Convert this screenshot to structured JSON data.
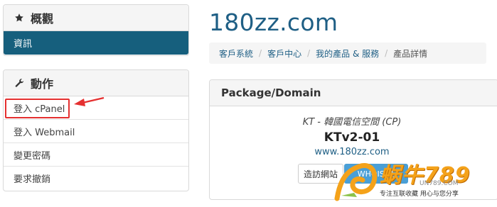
{
  "sidebar": {
    "overview": {
      "title": "概觀",
      "icon": "star-icon",
      "active_item": "資訊"
    },
    "actions": {
      "title": "動作",
      "icon": "wrench-icon",
      "items": [
        "登入 cPanel",
        "登入 Webmail",
        "變更密碼",
        "要求撤銷"
      ]
    }
  },
  "header": {
    "site_title": "180zz.com"
  },
  "breadcrumb": [
    "客戶系統",
    "客戶中心",
    "我的產品 & 服務",
    "產品詳情"
  ],
  "product": {
    "card_title": "Package/Domain",
    "group": "KT - 韓國電信空間 (CP)",
    "name": "KTv2-01",
    "domain": "www.180zz.com",
    "visit_button": "造訪網站",
    "whois_button": "WHOIS 查"
  },
  "watermark": {
    "main": "蜗牛789",
    "url": "UN789.COM",
    "slogan": "专注互联收藏   用心与您分享"
  },
  "colors": {
    "accent": "#165f7d",
    "link": "#1f5f85",
    "highlight": "#e53030"
  }
}
